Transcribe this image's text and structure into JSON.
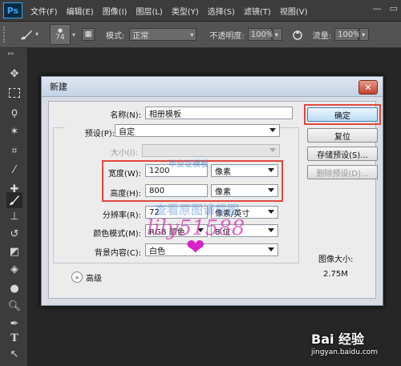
{
  "app": {
    "logo": "Ps"
  },
  "menu": [
    "文件(F)",
    "编辑(E)",
    "图像(I)",
    "图层(L)",
    "类型(Y)",
    "选择(S)",
    "滤镜(T)",
    "视图(V)"
  ],
  "options": {
    "brush_size": "74",
    "mode_label": "模式:",
    "mode_value": "正常",
    "opacity_label": "不透明度:",
    "opacity_value": "100%",
    "flow_label": "流量:",
    "flow_value": "100%"
  },
  "dialog": {
    "title": "新建",
    "name_label": "名称(N):",
    "name_value": "相册模板",
    "preset_label": "预设(P):",
    "preset_value": "自定",
    "size_label": "大小(I):",
    "width_label": "宽度(W):",
    "width_value": "1200",
    "width_unit": "像素",
    "height_label": "高度(H):",
    "height_value": "800",
    "height_unit": "像素",
    "resolution_label": "分辨率(R):",
    "resolution_value": "72",
    "resolution_unit": "像素/英寸",
    "colormode_label": "颜色模式(M):",
    "colormode_value": "RGB 颜色",
    "colordepth_value": "8 位",
    "background_label": "背景内容(C):",
    "background_value": "白色",
    "advanced_label": "高级",
    "ok_button": "确定",
    "reset_button": "复位",
    "save_preset_button": "存储预设(S)...",
    "delete_preset_button": "删除预设(D)...",
    "image_size_label": "图像大小:",
    "image_size_value": "2.75M"
  },
  "watermarks": {
    "pink": "lily51588",
    "blue": "查看原图请截图",
    "logo": "毕业证模板",
    "baidu_brand": "Bai 经验",
    "baidu_url": "jingyan.baidu.com"
  },
  "colors": {
    "highlight": "#e0473f",
    "photoshop_blue": "#31a8ff"
  }
}
